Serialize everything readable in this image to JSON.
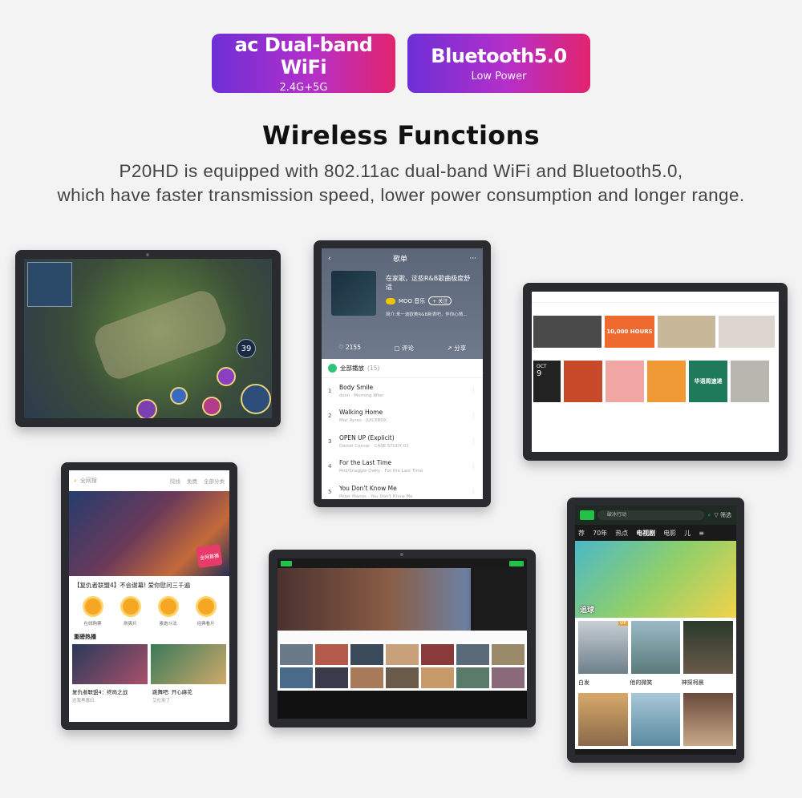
{
  "badges": [
    {
      "title": "ac Dual-band WiFi",
      "subtitle": "2.4G+5G"
    },
    {
      "title": "Bluetooth5.0",
      "subtitle": "Low Power"
    }
  ],
  "headline": "Wireless Functions",
  "description": [
    "P20HD is equipped with 802.11ac dual-band WiFi and Bluetooth5.0,",
    "which have faster transmission speed, lower power consumption and longer range."
  ],
  "music_app": {
    "title": "歌单",
    "playlist_name": "在家歌，这些R&B歌曲极度舒适",
    "author": "MOO 音乐",
    "follow": "+ 关注",
    "intro": "简介:来一波欧美R&B新表吧，伴你心情...",
    "likes": "2155",
    "comment": "评论",
    "share": "分享",
    "play_all": "全部播放",
    "count": "(15)",
    "songs": [
      {
        "num": "1",
        "title": "Body Smile",
        "sub": "dvsn · Morning After"
      },
      {
        "num": "2",
        "title": "Walking Home",
        "sub": "Mac Ayres · JUICEBOX"
      },
      {
        "num": "3",
        "title": "OPEN UP (Explicit)",
        "sub": "Daniel Caesar · CASE STUDY 01"
      },
      {
        "num": "4",
        "title": "For the Last Time",
        "sub": "Rini/Snaggle Owky · For the Last Time"
      },
      {
        "num": "5",
        "title": "You Don't Know Me",
        "sub": "Peter Manos · You Don't Know Me"
      }
    ]
  },
  "game": {
    "counter": "39"
  },
  "desktop": {
    "promo": "10,000 HOURS",
    "promo2": "华语周速递",
    "date_month": "OCT",
    "date_day": "9"
  },
  "movie_app": {
    "search": "全网搜",
    "tabs": [
      "院线",
      "免费",
      "全部分类"
    ],
    "banner_badge": "全网首播",
    "caption": "【复仇者联盟4】不会谢幕! 爱你慰问三千遍",
    "icons": [
      "在线购票",
      "刷爽片",
      "素炮斗法",
      "经典看片"
    ],
    "section": "重磅热播",
    "thumbs": [
      {
        "title": "复仇者联盟4：终局之战",
        "sub": "还我黑寡妇"
      },
      {
        "title": "跳舞吧: 开心麻花",
        "sub": "艾伦来了"
      }
    ]
  },
  "drama_app": {
    "search": "破冰行动",
    "filter": "筛选",
    "tabs": [
      "荐",
      "70年",
      "热点",
      "电视剧",
      "电影",
      "儿"
    ],
    "banner_title": "追球",
    "names": [
      "白发",
      "他的微笑",
      "神探柯晨"
    ]
  },
  "colors": {
    "badge_gradient": [
      "#6d2fd6",
      "#b52fc9",
      "#e2246e"
    ],
    "qq_music_green": "#31c27c",
    "iqiyi_green": "#21c14a"
  }
}
